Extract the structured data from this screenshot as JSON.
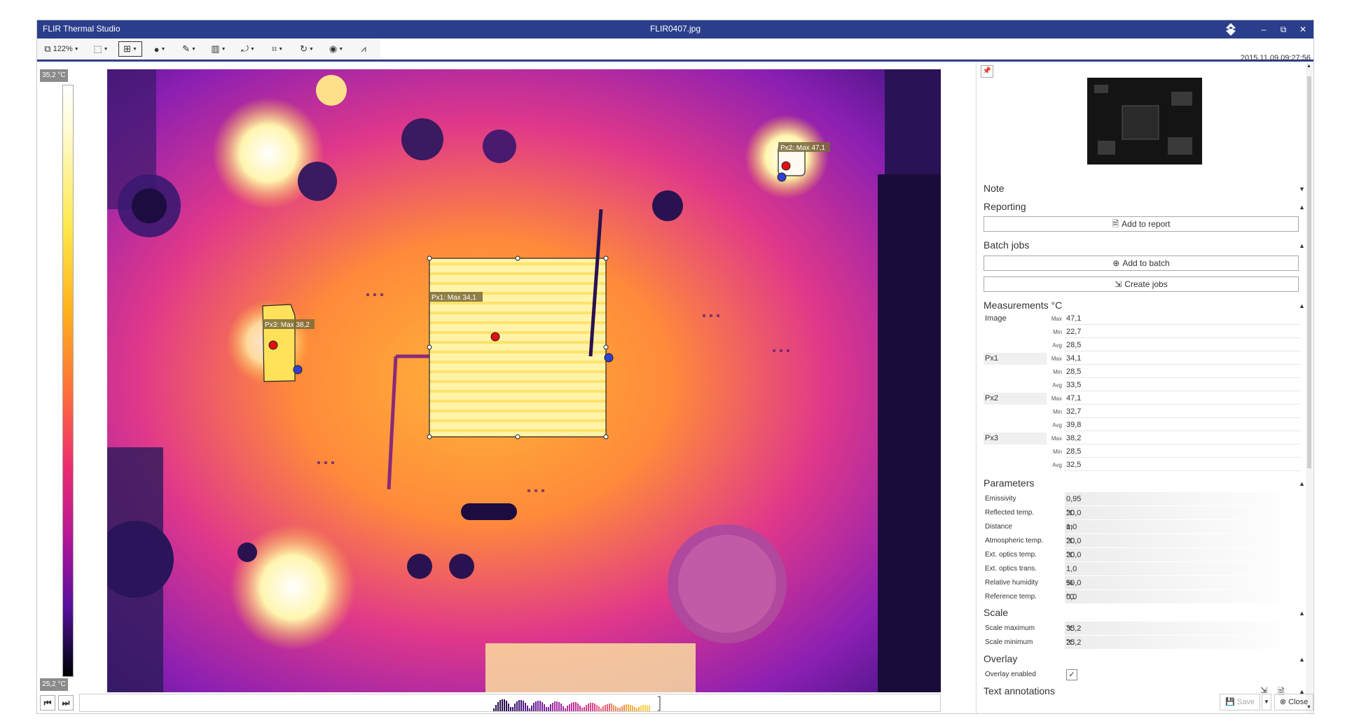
{
  "titlebar": {
    "app_title": "FLIR Thermal Studio",
    "file_name": "FLIR0407.jpg",
    "minimize": "–",
    "restore": "⧉",
    "close": "✕"
  },
  "toolbar": {
    "zoom_label": "122%",
    "items": [
      "zoom-dropdown",
      "image-mode",
      "measurement-tools",
      "palette",
      "annotation",
      "histogram",
      "rotate",
      "crop",
      "refresh",
      "fusion",
      "plot"
    ]
  },
  "datetime": "2015.11.09 09:27:56",
  "scale": {
    "max_label": "35,2 °C",
    "min_label": "25,2 °C"
  },
  "regions": [
    {
      "name": "Px1",
      "label": "Px1:  Max 34,1"
    },
    {
      "name": "Px2",
      "label": "Px2:  Max 47,1"
    },
    {
      "name": "Px3",
      "label": "Px3:  Max 38,2"
    }
  ],
  "panel": {
    "note": "Note",
    "reporting": "Reporting",
    "add_to_report": "Add to report",
    "batch_jobs": "Batch jobs",
    "add_to_batch": "Add to batch",
    "create_jobs": "Create jobs",
    "measurements_title": "Measurements °C",
    "measurements": [
      {
        "source": "Image",
        "max": "47,1",
        "min": "22,7",
        "avg": "28,5"
      },
      {
        "source": "Px1",
        "max": "34,1",
        "min": "28,5",
        "avg": "33,5"
      },
      {
        "source": "Px2",
        "max": "47,1",
        "min": "32,7",
        "avg": "39,8"
      },
      {
        "source": "Px3",
        "max": "38,2",
        "min": "28,5",
        "avg": "32,5"
      }
    ],
    "stat_labels": {
      "max": "Max",
      "min": "Min",
      "avg": "Avg"
    },
    "parameters_title": "Parameters",
    "parameters": [
      {
        "label": "Emissivity",
        "value": "0,95",
        "unit": ""
      },
      {
        "label": "Reflected temp.",
        "value": "20,0",
        "unit": "°C"
      },
      {
        "label": "Distance",
        "value": "1,0",
        "unit": "m"
      },
      {
        "label": "Atmospheric temp.",
        "value": "20,0",
        "unit": "°C"
      },
      {
        "label": "Ext. optics temp.",
        "value": "20,0",
        "unit": "°C"
      },
      {
        "label": "Ext. optics trans.",
        "value": "1,0",
        "unit": ""
      },
      {
        "label": "Relative humidity",
        "value": "50,0",
        "unit": "%"
      },
      {
        "label": "Reference temp.",
        "value": "0,0",
        "unit": "°C"
      }
    ],
    "scale_title": "Scale",
    "scale_params": [
      {
        "label": "Scale maximum",
        "value": "35,2",
        "unit": "°C"
      },
      {
        "label": "Scale minimum",
        "value": "25,2",
        "unit": "°C"
      }
    ],
    "overlay_title": "Overlay",
    "overlay_enabled_label": "Overlay enabled",
    "overlay_enabled": true,
    "text_annotations": "Text annotations"
  },
  "bottom": {
    "save": "Save",
    "close": "Close"
  }
}
